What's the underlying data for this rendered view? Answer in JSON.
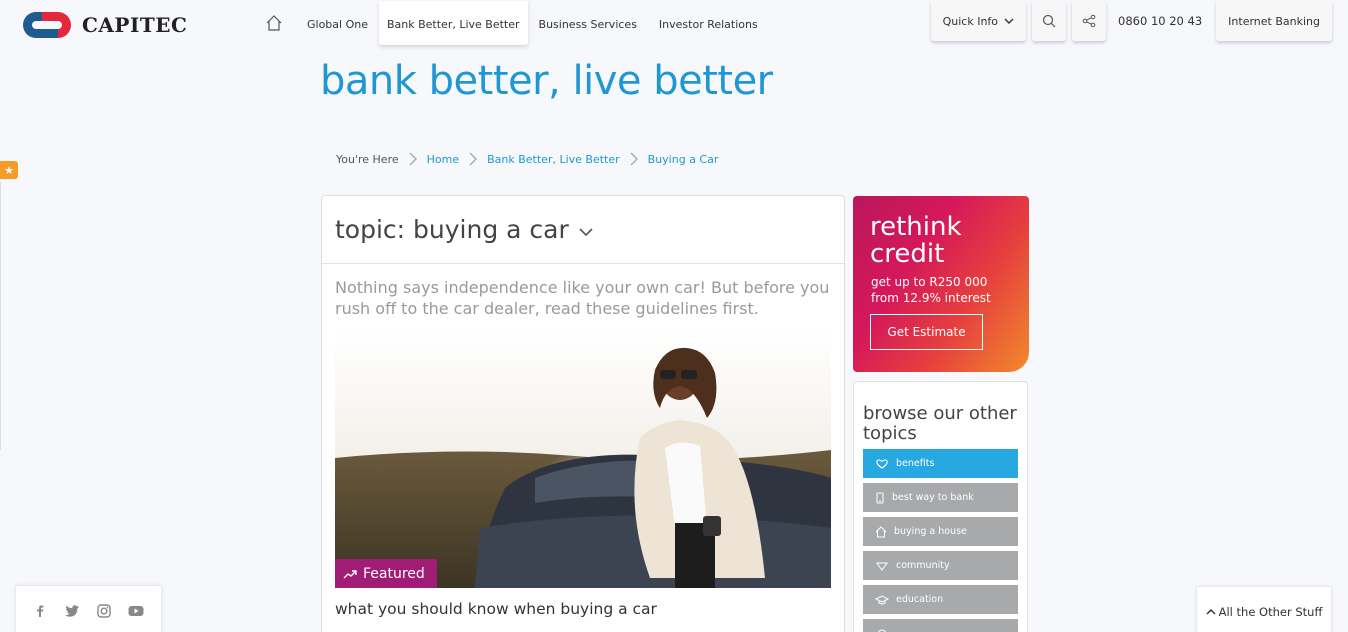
{
  "brand": {
    "name": "CAPITEC",
    "red": "#e3283c",
    "blue": "#1e5b8e"
  },
  "nav": {
    "home_icon": "home-icon",
    "items": [
      {
        "label": "Global One"
      },
      {
        "label": "Bank Better, Live Better",
        "active": true
      },
      {
        "label": "Business Services"
      },
      {
        "label": "Investor Relations"
      }
    ]
  },
  "tools": {
    "quick_info": "Quick Info",
    "phone": "0860 10 20 43",
    "internet_banking": "Internet Banking"
  },
  "page": {
    "title": "bank better, live better"
  },
  "breadcrumb": {
    "here": "You're Here",
    "items": [
      "Home",
      "Bank Better, Live Better",
      "Buying a Car"
    ]
  },
  "topic": {
    "title": "topic: buying a car",
    "intro": "Nothing says independence like your own car! But before you rush off to the car dealer, read these guidelines first.",
    "featured_label": "Featured",
    "article_title": "what you should know when buying a car"
  },
  "promo": {
    "line1": "rethink",
    "line2": "credit",
    "sub1": "get up to R250 000",
    "sub2": "from 12.9% interest",
    "button": "Get Estimate"
  },
  "browse": {
    "title": "browse our other topics",
    "topics": [
      {
        "label": "benefits",
        "icon": "heart-hands-icon",
        "active": true
      },
      {
        "label": "best way to bank",
        "icon": "phone-icon"
      },
      {
        "label": "buying a house",
        "icon": "house-icon"
      },
      {
        "label": "community",
        "icon": "hearts-icon"
      },
      {
        "label": "education",
        "icon": "graduation-cap-icon"
      }
    ]
  },
  "footer": {
    "other_stuff": "All the Other Stuff"
  }
}
